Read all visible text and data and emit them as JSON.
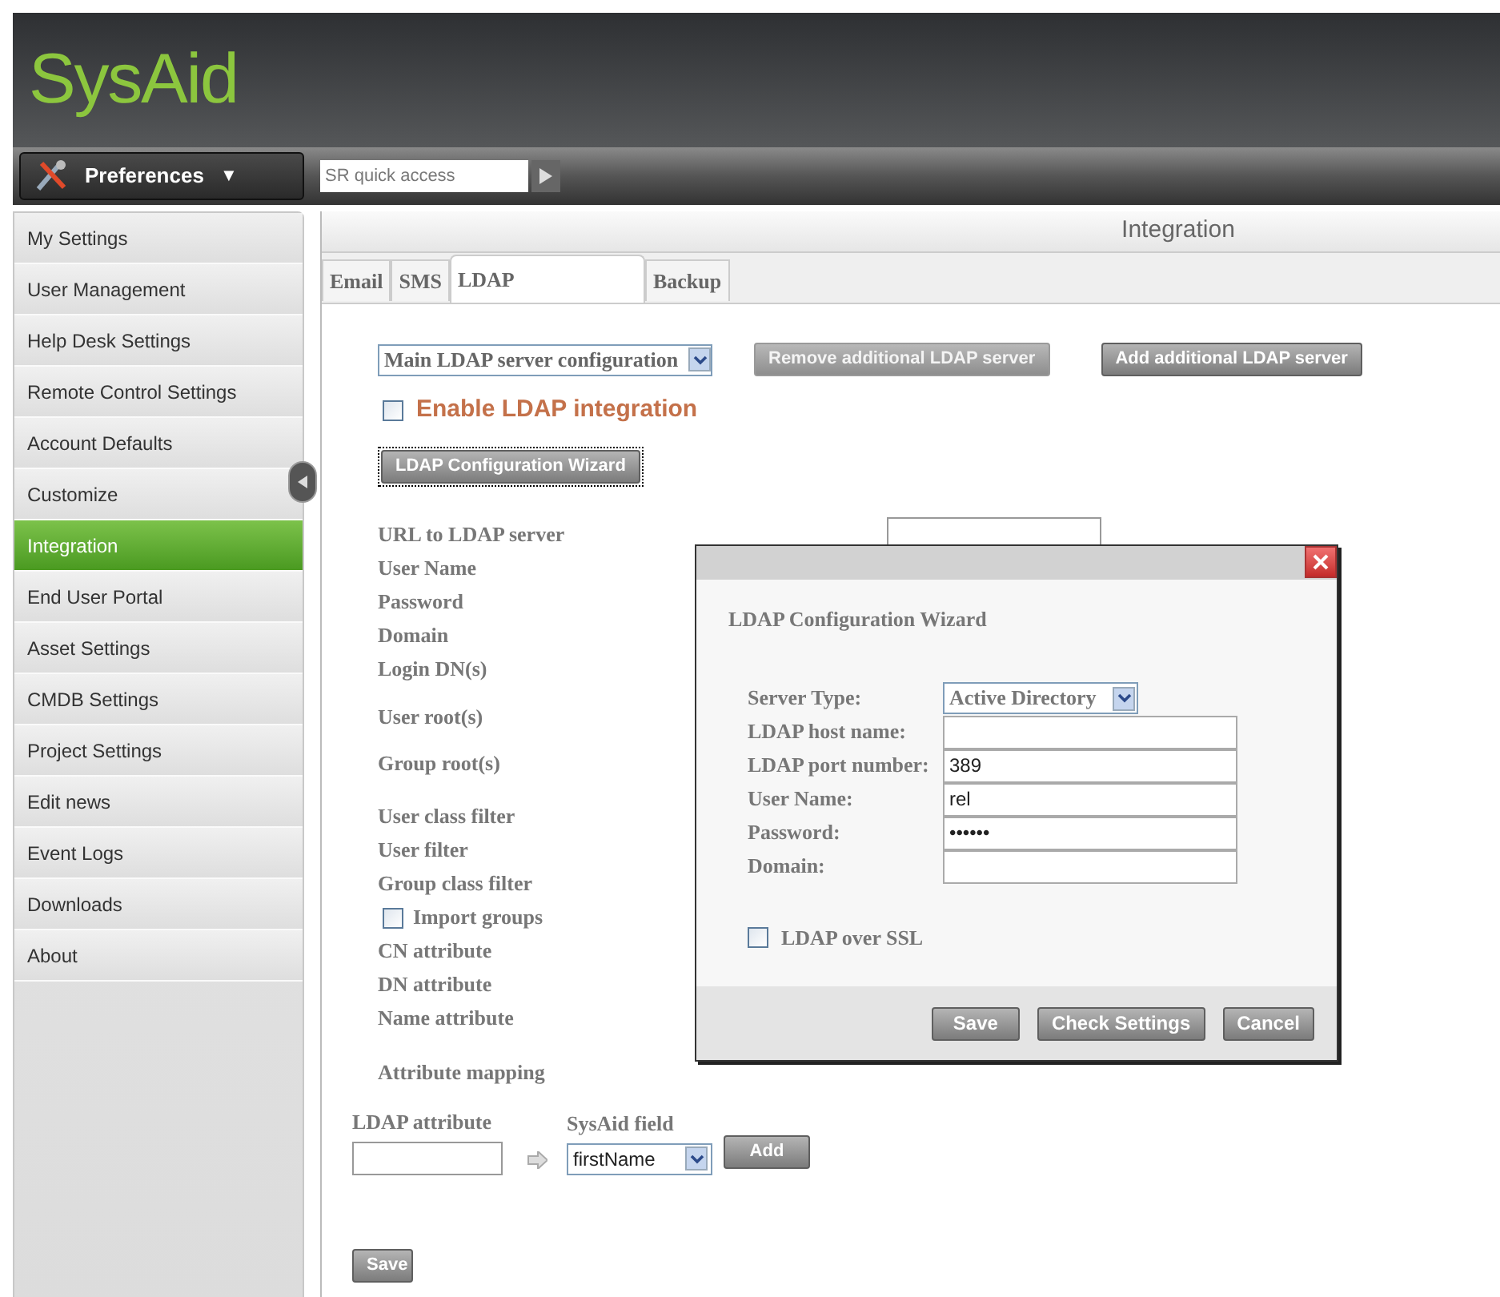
{
  "logo": "SysAid",
  "nav": {
    "menu_button": "Preferences",
    "menu_caret": "▼",
    "quick_access": {
      "placeholder": "SR quick access"
    }
  },
  "sidebar": {
    "items": [
      {
        "label": "My Settings",
        "selected": false
      },
      {
        "label": "User Management",
        "selected": false
      },
      {
        "label": "Help Desk Settings",
        "selected": false
      },
      {
        "label": "Remote Control Settings",
        "selected": false
      },
      {
        "label": "Account Defaults",
        "selected": false
      },
      {
        "label": "Customize",
        "selected": false
      },
      {
        "label": "Integration",
        "selected": true
      },
      {
        "label": "End User Portal",
        "selected": false
      },
      {
        "label": "Asset Settings",
        "selected": false
      },
      {
        "label": "CMDB Settings",
        "selected": false
      },
      {
        "label": "Project Settings",
        "selected": false
      },
      {
        "label": "Edit news",
        "selected": false
      },
      {
        "label": "Event Logs",
        "selected": false
      },
      {
        "label": "Downloads",
        "selected": false
      },
      {
        "label": "About",
        "selected": false
      }
    ]
  },
  "content": {
    "title": "Integration",
    "tabs": [
      {
        "label": "Email",
        "selected": false
      },
      {
        "label": "SMS",
        "selected": false
      },
      {
        "label": "LDAP",
        "selected": true
      },
      {
        "label": "Backup",
        "selected": false
      }
    ],
    "server_select": {
      "value": "Main LDAP server configuration"
    },
    "remove_button": {
      "label": "Remove additional LDAP server",
      "disabled": true
    },
    "add_button": {
      "label": "Add additional LDAP server",
      "disabled": false
    },
    "enable": {
      "label": "Enable LDAP integration",
      "checked": false
    },
    "wizard_button": "LDAP Configuration Wizard",
    "fields": [
      {
        "kind": "field",
        "label": "URL to LDAP server"
      },
      {
        "kind": "label",
        "label": "User Name"
      },
      {
        "kind": "label",
        "label": "Password"
      },
      {
        "kind": "label",
        "label": "Domain"
      },
      {
        "kind": "label",
        "label": "Login DN(s)"
      },
      {
        "kind": "label",
        "label": "User root(s)"
      },
      {
        "kind": "label",
        "label": "Group root(s)"
      },
      {
        "kind": "label",
        "label": "User class filter"
      },
      {
        "kind": "label",
        "label": "User filter"
      },
      {
        "kind": "label",
        "label": "Group class filter"
      },
      {
        "kind": "checkbox",
        "label": "Import groups",
        "checked": false
      },
      {
        "kind": "label",
        "label": "CN attribute"
      },
      {
        "kind": "label",
        "label": "DN attribute"
      },
      {
        "kind": "label",
        "label": "Name attribute"
      }
    ],
    "attribute_mapping": {
      "title": "Attribute mapping",
      "ldap_attribute_label": "LDAP attribute",
      "sysaid_field_label": "SysAid field",
      "sysaid_field_value": "firstName",
      "add_button": "Add"
    },
    "save_button": "Save"
  },
  "dialog": {
    "title": "LDAP Configuration Wizard",
    "fields": [
      {
        "kind": "select",
        "label": "Server Type:",
        "value": "Active Directory"
      },
      {
        "kind": "text",
        "label": "LDAP host name:"
      },
      {
        "kind": "text",
        "label": "LDAP port number:",
        "value": "389"
      },
      {
        "kind": "text",
        "label": "User Name:",
        "value": "rel"
      },
      {
        "kind": "text",
        "label": "Password:",
        "value": "••••••"
      },
      {
        "kind": "text",
        "label": "Domain:"
      }
    ],
    "ssl": {
      "label": "LDAP over SSL",
      "checked": false
    },
    "buttons": [
      "Save",
      "Check Settings",
      "Cancel"
    ]
  }
}
